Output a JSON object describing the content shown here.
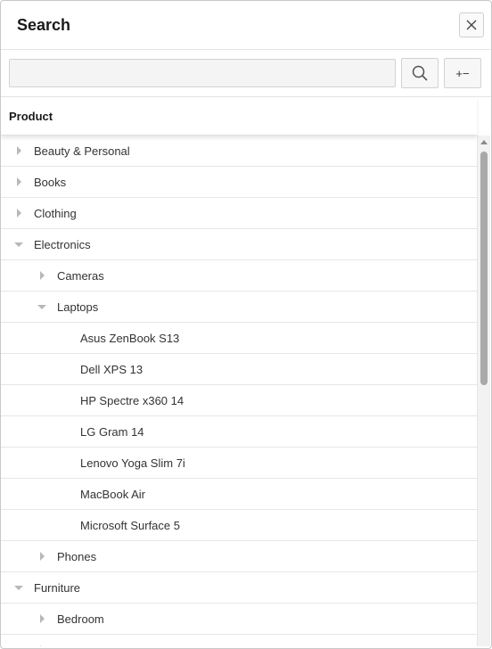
{
  "dialog": {
    "title": "Search",
    "close_icon": "close-icon"
  },
  "toolbar": {
    "search_value": "",
    "search_placeholder": "",
    "search_icon": "search-icon",
    "expand_collapse_label": "+−"
  },
  "column": {
    "header": "Product"
  },
  "tree": {
    "rows": [
      {
        "label": "Beauty & Personal",
        "level": 0,
        "state": "collapsed"
      },
      {
        "label": "Books",
        "level": 0,
        "state": "collapsed"
      },
      {
        "label": "Clothing",
        "level": 0,
        "state": "collapsed"
      },
      {
        "label": "Electronics",
        "level": 0,
        "state": "expanded"
      },
      {
        "label": "Cameras",
        "level": 1,
        "state": "collapsed"
      },
      {
        "label": "Laptops",
        "level": 1,
        "state": "expanded"
      },
      {
        "label": "Asus ZenBook S13",
        "level": 2,
        "state": "leaf"
      },
      {
        "label": "Dell XPS 13",
        "level": 2,
        "state": "leaf"
      },
      {
        "label": "HP Spectre x360 14",
        "level": 2,
        "state": "leaf"
      },
      {
        "label": "LG Gram 14",
        "level": 2,
        "state": "leaf"
      },
      {
        "label": "Lenovo Yoga Slim 7i",
        "level": 2,
        "state": "leaf"
      },
      {
        "label": "MacBook Air",
        "level": 2,
        "state": "leaf"
      },
      {
        "label": "Microsoft Surface 5",
        "level": 2,
        "state": "leaf"
      },
      {
        "label": "Phones",
        "level": 1,
        "state": "collapsed"
      },
      {
        "label": "Furniture",
        "level": 0,
        "state": "expanded"
      },
      {
        "label": "Bedroom",
        "level": 1,
        "state": "collapsed"
      },
      {
        "label": "",
        "level": 1,
        "state": "collapsed"
      }
    ]
  },
  "colors": {
    "border": "#c8c8c8",
    "row_divider": "#e6e6e6",
    "arrow": "#b8b8b8",
    "input_bg": "#f4f4f4"
  }
}
